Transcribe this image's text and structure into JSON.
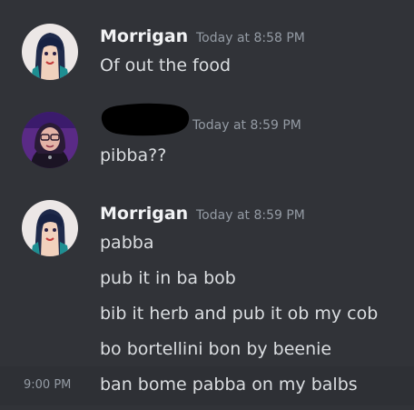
{
  "colors": {
    "background": "#313338",
    "hover_background": "#2e3035",
    "username": "#f2f3f5",
    "message_text": "#dbdee1",
    "timestamp": "#949ba4"
  },
  "messages": [
    {
      "author": "Morrigan",
      "timestamp": "Today at 8:58 PM",
      "avatar_icon": "anime-character-avatar-icon",
      "lines": [
        "Of out the food"
      ]
    },
    {
      "author": "",
      "author_redacted": true,
      "timestamp": "Today at 8:59 PM",
      "avatar_icon": "user-photo-avatar-icon",
      "lines": [
        "pibba??"
      ]
    },
    {
      "author": "Morrigan",
      "timestamp": "Today at 8:59 PM",
      "avatar_icon": "anime-character-avatar-icon",
      "lines": [
        "pabba",
        "pub it in ba bob",
        "bib it herb and pub it ob my cob",
        "bo bortellini bon by beenie"
      ]
    }
  ],
  "hovered_message": {
    "side_time": "9:00 PM",
    "text": "ban bome pabba on my balbs"
  }
}
